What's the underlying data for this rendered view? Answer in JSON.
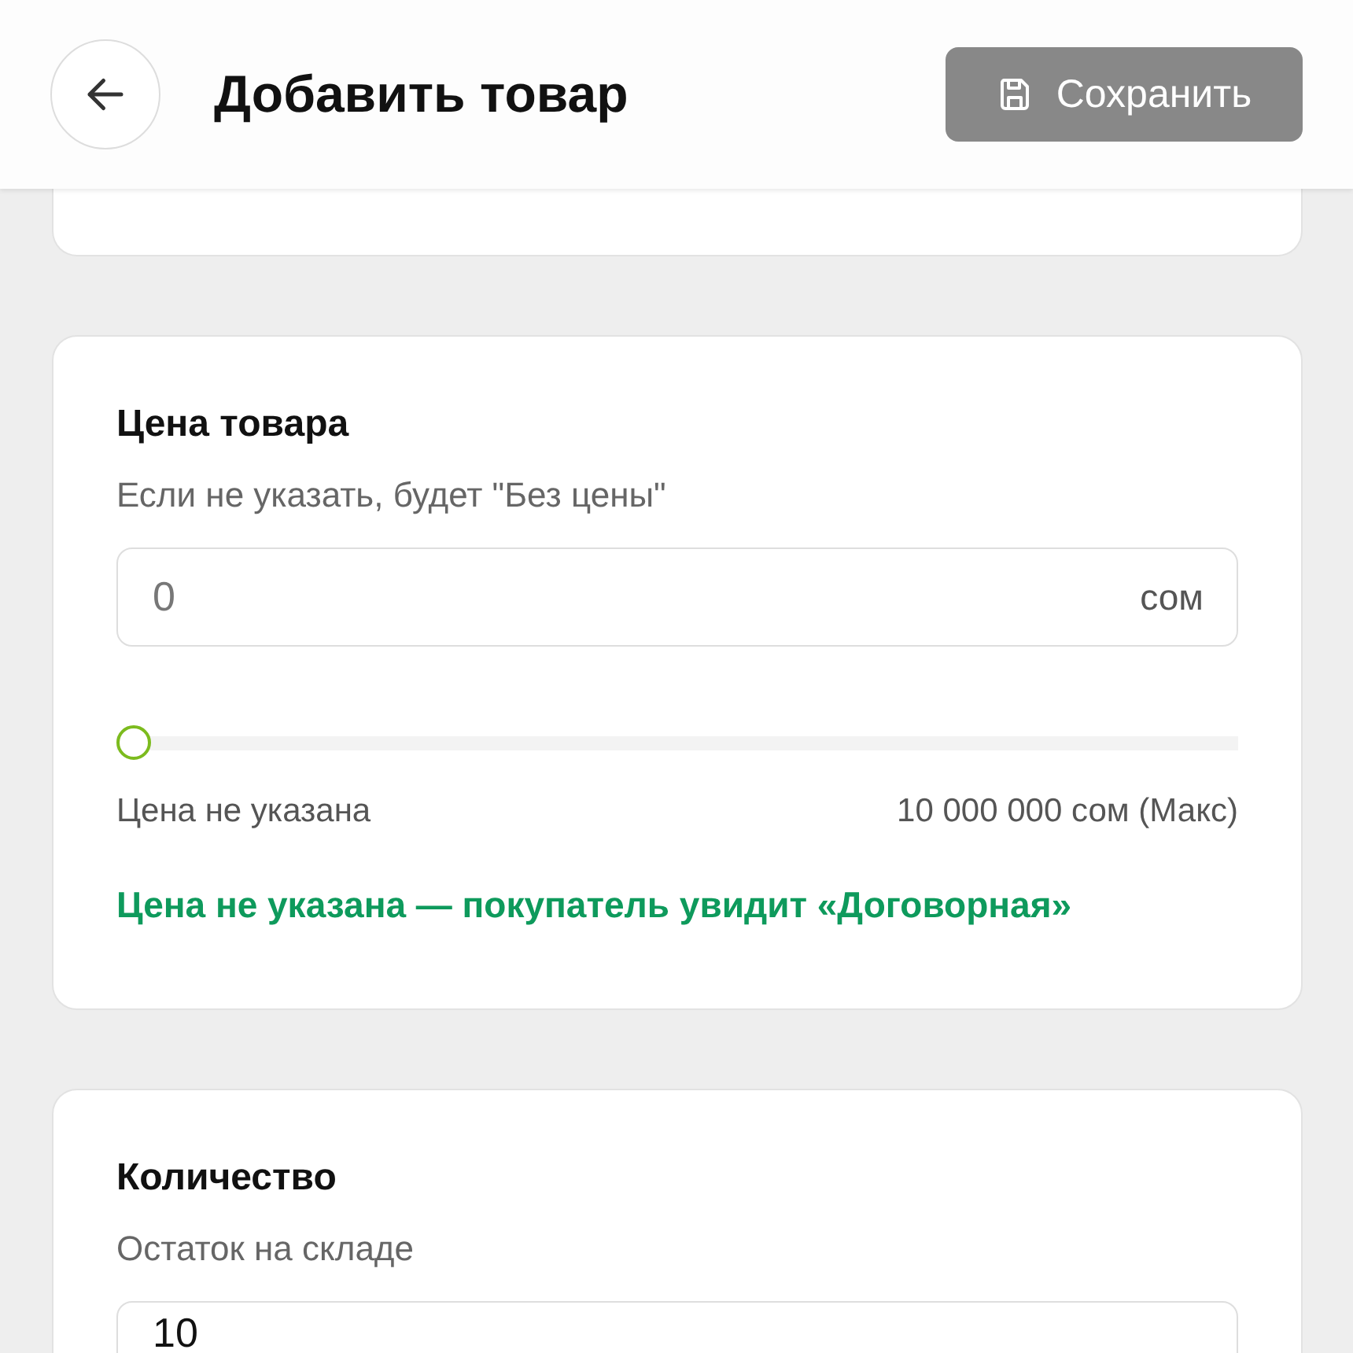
{
  "header": {
    "title": "Добавить товар",
    "save_button": {
      "label": "Сохранить",
      "disabled": true
    }
  },
  "price": {
    "title": "Цена товара",
    "hint": "Если не указать, будет \"Без цены\"",
    "input": {
      "value": "0",
      "suffix": "сом"
    },
    "slider": {
      "level": 0
    },
    "min_label": "Цена не указана",
    "max_label": "10 000 000 сом (Макс)",
    "message": "Цена не указана — покупатель увидит «Договорная»"
  },
  "quantity": {
    "title": "Количество",
    "hint": "Остаток на складе",
    "input": {
      "value": "10"
    }
  }
}
